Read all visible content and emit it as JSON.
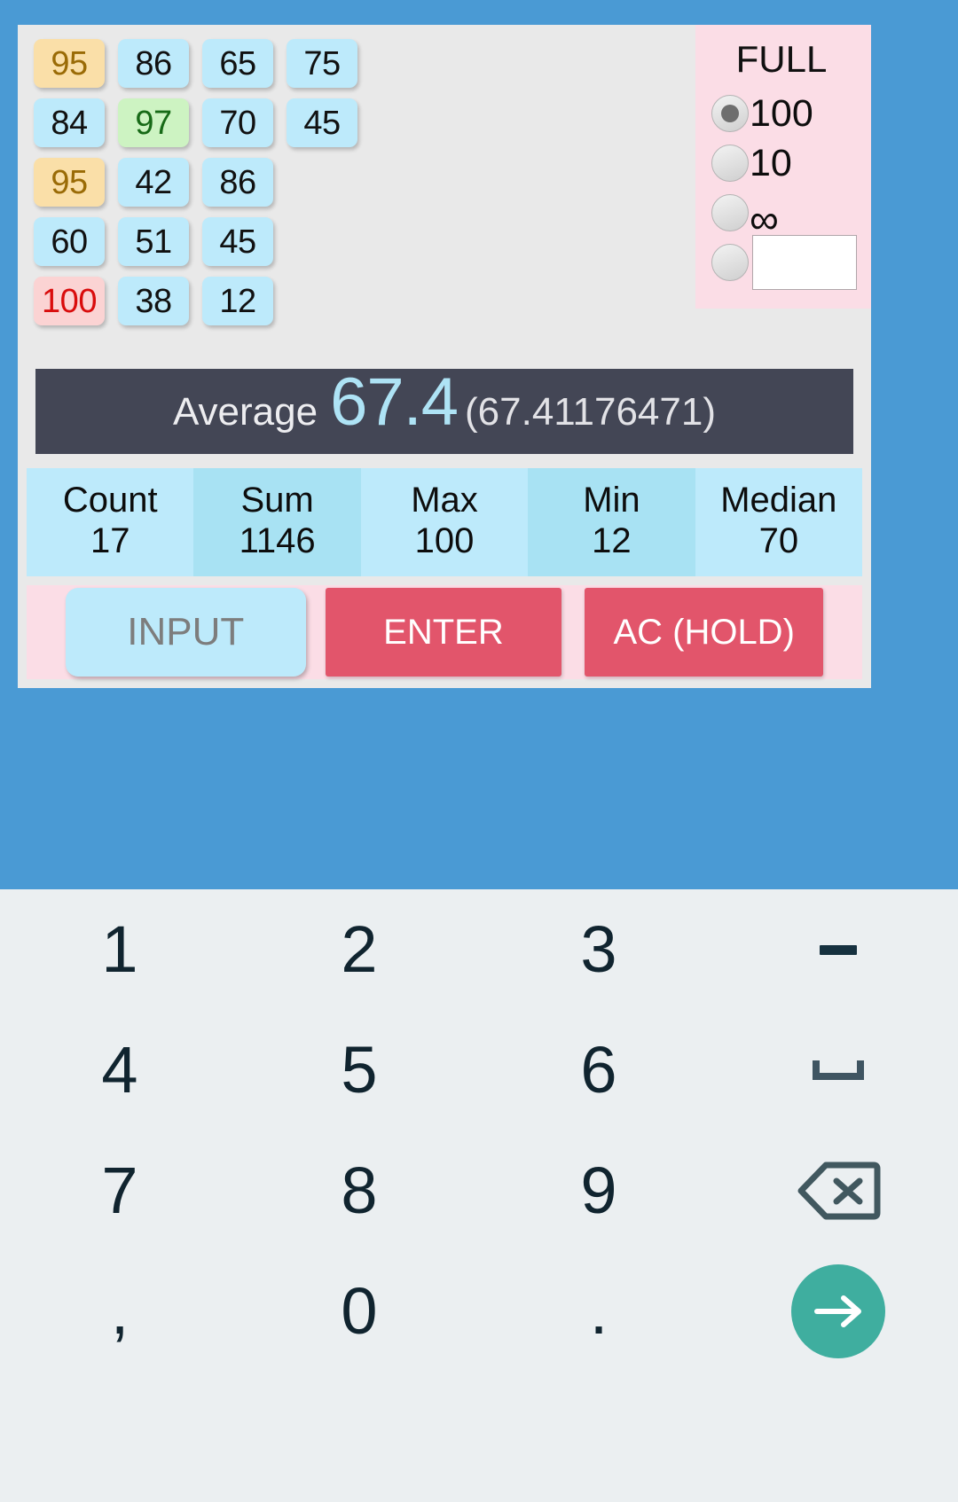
{
  "app": {
    "background_color": "#4a9ad4",
    "card_color": "#e9e9e9"
  },
  "numbers": {
    "rows": [
      [
        {
          "value": "95",
          "style": "orange"
        },
        {
          "value": "86",
          "style": "normal"
        },
        {
          "value": "65",
          "style": "normal"
        },
        {
          "value": "75",
          "style": "normal"
        }
      ],
      [
        {
          "value": "84",
          "style": "normal"
        },
        {
          "value": "97",
          "style": "green"
        },
        {
          "value": "70",
          "style": "normal"
        },
        {
          "value": "45",
          "style": "normal"
        }
      ],
      [
        {
          "value": "95",
          "style": "orange"
        },
        {
          "value": "42",
          "style": "normal"
        },
        {
          "value": "86",
          "style": "normal"
        }
      ],
      [
        {
          "value": "60",
          "style": "normal"
        },
        {
          "value": "51",
          "style": "normal"
        },
        {
          "value": "45",
          "style": "normal"
        }
      ],
      [
        {
          "value": "100",
          "style": "red"
        },
        {
          "value": "38",
          "style": "normal"
        },
        {
          "value": "12",
          "style": "normal"
        }
      ]
    ]
  },
  "full_panel": {
    "title": "FULL",
    "options": [
      {
        "label": "100",
        "selected": true
      },
      {
        "label": "10",
        "selected": false
      },
      {
        "label": "∞",
        "selected": false
      }
    ],
    "custom": {
      "selected": false,
      "value": "",
      "placeholder": ""
    },
    "panel_color": "#fbdde6"
  },
  "average": {
    "label": "Average",
    "value": "67.4",
    "exact": "(67.41176471)",
    "bar_color": "#434655",
    "value_color": "#aee3f5"
  },
  "stats": [
    {
      "label": "Count",
      "value": "17"
    },
    {
      "label": "Sum",
      "value": "1146"
    },
    {
      "label": "Max",
      "value": "100"
    },
    {
      "label": "Min",
      "value": "12"
    },
    {
      "label": "Median",
      "value": "70"
    }
  ],
  "actions": {
    "input_label": "INPUT",
    "enter_label": "ENTER",
    "ac_label": "AC (HOLD)",
    "accent_color": "#e2556b"
  },
  "keyboard": {
    "rows": [
      [
        {
          "label": "1",
          "name": "key-1",
          "type": "text"
        },
        {
          "label": "2",
          "name": "key-2",
          "type": "text"
        },
        {
          "label": "3",
          "name": "key-3",
          "type": "text"
        },
        {
          "label": "-",
          "name": "key-minus",
          "type": "minus"
        }
      ],
      [
        {
          "label": "4",
          "name": "key-4",
          "type": "text"
        },
        {
          "label": "5",
          "name": "key-5",
          "type": "text"
        },
        {
          "label": "6",
          "name": "key-6",
          "type": "text"
        },
        {
          "label": " ",
          "name": "key-space",
          "type": "space"
        }
      ],
      [
        {
          "label": "7",
          "name": "key-7",
          "type": "text"
        },
        {
          "label": "8",
          "name": "key-8",
          "type": "text"
        },
        {
          "label": "9",
          "name": "key-9",
          "type": "text"
        },
        {
          "label": "",
          "name": "key-backspace",
          "type": "backspace"
        }
      ],
      [
        {
          "label": ",",
          "name": "key-comma",
          "type": "text"
        },
        {
          "label": "0",
          "name": "key-0",
          "type": "text"
        },
        {
          "label": ".",
          "name": "key-period",
          "type": "text"
        },
        {
          "label": "",
          "name": "key-submit",
          "type": "submit"
        }
      ]
    ],
    "background_color": "#ebeff1",
    "submit_color": "#3fae9f"
  }
}
